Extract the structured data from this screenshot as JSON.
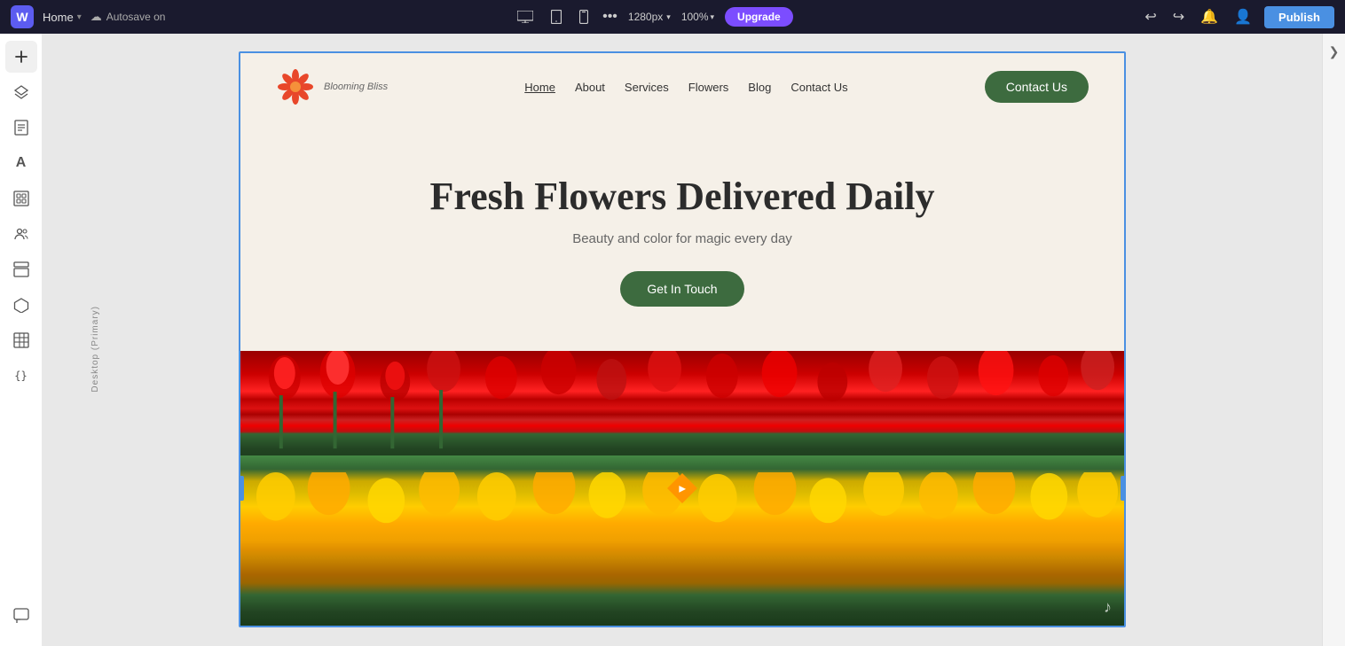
{
  "topbar": {
    "logo_label": "W",
    "page_name": "Home",
    "autosave_text": "Autosave on",
    "viewport_size": "1280px",
    "zoom_level": "100%",
    "upgrade_label": "Upgrade",
    "publish_label": "Publish",
    "undo_icon": "↩",
    "redo_icon": "↪",
    "bell_icon": "🔔",
    "user_icon": "👤",
    "more_icon": "•••",
    "desktop_icon": "🖥",
    "tablet_icon": "📱",
    "mobile_icon": "📱"
  },
  "sidebar": {
    "icons": [
      {
        "name": "add-icon",
        "symbol": "+",
        "label": "Add"
      },
      {
        "name": "layers-icon",
        "symbol": "⬡",
        "label": "Layers"
      },
      {
        "name": "pages-icon",
        "symbol": "☰",
        "label": "Pages"
      },
      {
        "name": "text-icon",
        "symbol": "A",
        "label": "Text"
      },
      {
        "name": "media-icon",
        "symbol": "⊞",
        "label": "Media"
      },
      {
        "name": "members-icon",
        "symbol": "👥",
        "label": "Members"
      },
      {
        "name": "sections-icon",
        "symbol": "⊟",
        "label": "Sections"
      },
      {
        "name": "apps-icon",
        "symbol": "⬡",
        "label": "Apps"
      },
      {
        "name": "table-icon",
        "symbol": "⊞",
        "label": "Table"
      },
      {
        "name": "code-icon",
        "symbol": "{}",
        "label": "Dev Mode"
      }
    ],
    "bottom_icon": {
      "name": "chat-icon",
      "symbol": "💬",
      "label": "Chat"
    }
  },
  "canvas": {
    "desktop_label": "Desktop (Primary)"
  },
  "website": {
    "logo_text_line1": "Blooming Bliss",
    "nav_links": [
      {
        "label": "Home",
        "active": true
      },
      {
        "label": "About",
        "active": false
      },
      {
        "label": "Services",
        "active": false
      },
      {
        "label": "Flowers",
        "active": false
      },
      {
        "label": "Blog",
        "active": false
      },
      {
        "label": "Contact Us",
        "active": false
      }
    ],
    "contact_btn_label": "Contact Us",
    "hero_title": "Fresh Flowers Delivered Daily",
    "hero_subtitle": "Beauty and color for magic every day",
    "cta_label": "Get In Touch"
  }
}
